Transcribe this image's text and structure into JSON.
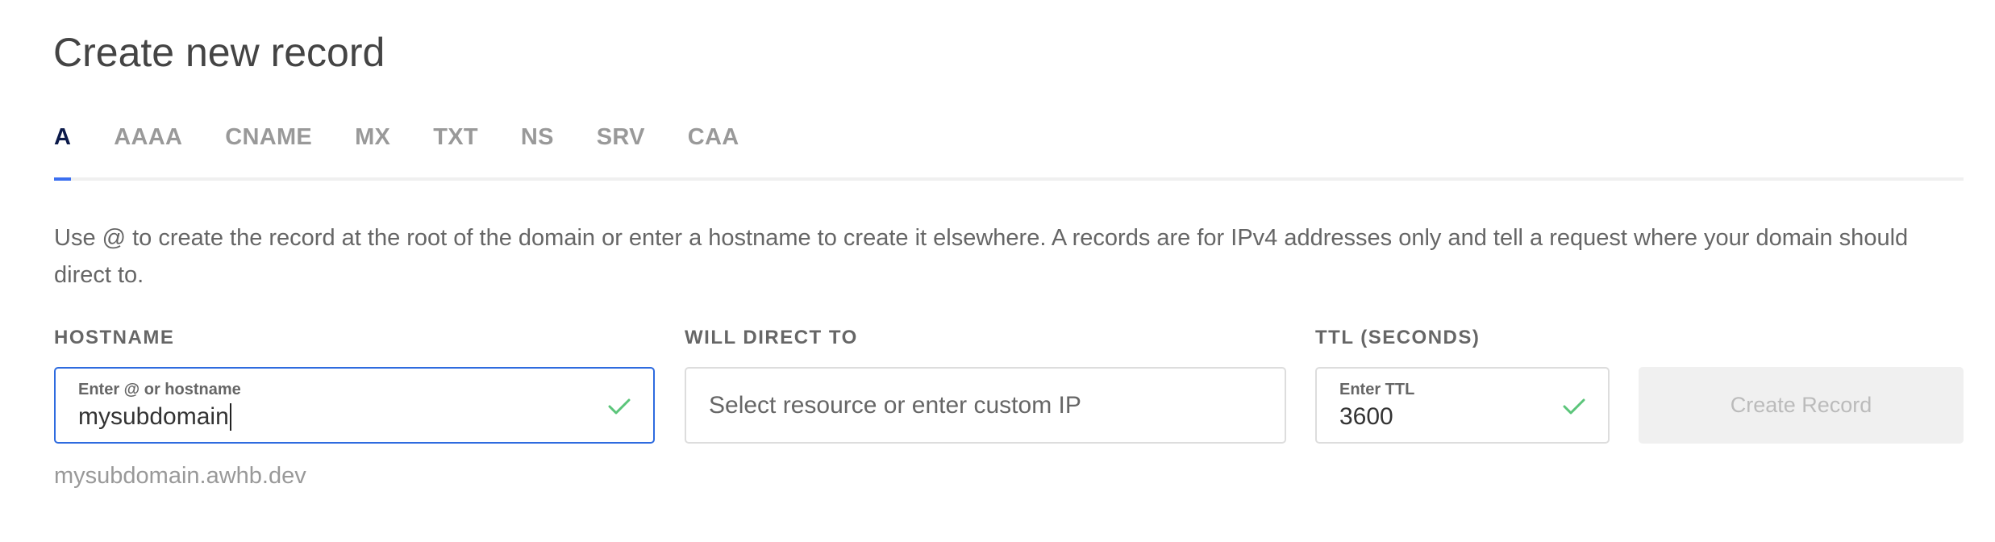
{
  "page": {
    "title": "Create new record"
  },
  "tabs": [
    {
      "label": "A",
      "active": true
    },
    {
      "label": "AAAA",
      "active": false
    },
    {
      "label": "CNAME",
      "active": false
    },
    {
      "label": "MX",
      "active": false
    },
    {
      "label": "TXT",
      "active": false
    },
    {
      "label": "NS",
      "active": false
    },
    {
      "label": "SRV",
      "active": false
    },
    {
      "label": "CAA",
      "active": false
    }
  ],
  "description": "Use @ to create the record at the root of the domain or enter a hostname to create it elsewhere. A records are for IPv4 addresses only and tell a request where your domain should direct to.",
  "form": {
    "hostname": {
      "label": "HOSTNAME",
      "float_label": "Enter @ or hostname",
      "value": "mysubdomain",
      "valid": true,
      "focused": true,
      "hint": "mysubdomain.awhb.dev"
    },
    "direct_to": {
      "label": "WILL DIRECT TO",
      "placeholder": "Select resource or enter custom IP",
      "value": ""
    },
    "ttl": {
      "label": "TTL (SECONDS)",
      "float_label": "Enter TTL",
      "value": "3600",
      "valid": true
    },
    "submit": {
      "label": "Create Record",
      "disabled": true
    }
  },
  "colors": {
    "accent": "#3b6ff0",
    "focus_border": "#2e6bdf",
    "valid_check": "#5bc57a",
    "active_tab": "#0b1a4a",
    "inactive_tab": "#999999",
    "disabled_button_bg": "#f0f0f0",
    "disabled_button_text": "#bbbbbb"
  },
  "icons": {
    "valid": "check-icon"
  }
}
